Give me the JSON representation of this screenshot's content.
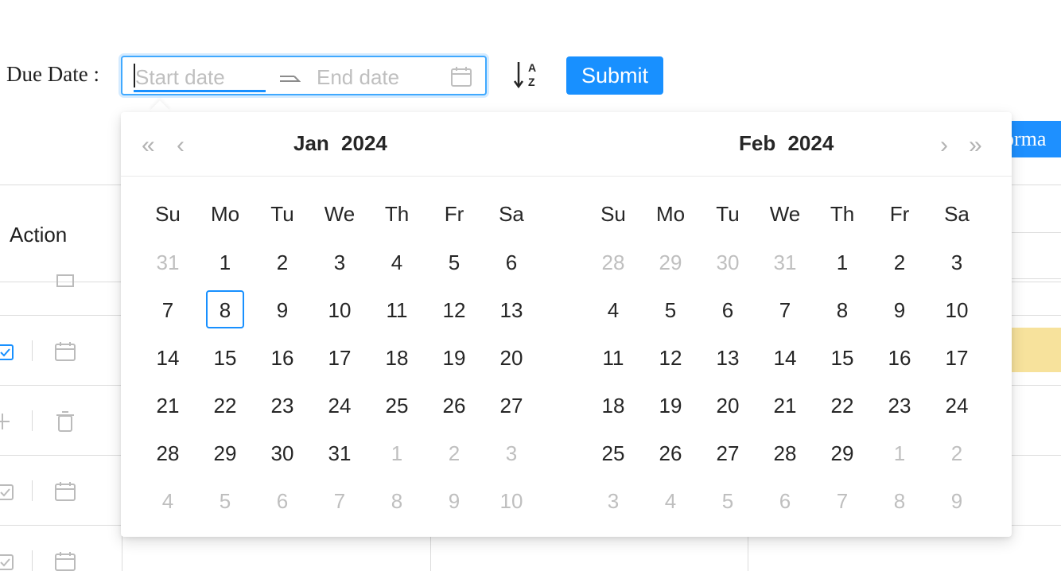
{
  "form": {
    "label": "Due Date :",
    "start_placeholder": "Start date",
    "end_placeholder": "End date",
    "submit_label": "Submit",
    "sort_icon": "sort-alpha-icon",
    "calendar_icon": "calendar-icon"
  },
  "background": {
    "column_header": "Action",
    "partial_button_label": "orma",
    "accent_color": "#1890ff",
    "highlight_color": "#f7e29c"
  },
  "picker": {
    "weekdays": [
      "Su",
      "Mo",
      "Tu",
      "We",
      "Th",
      "Fr",
      "Sa"
    ],
    "left": {
      "month": "Jan",
      "year": "2024",
      "weeks": [
        [
          {
            "d": "31",
            "out": true
          },
          {
            "d": "1"
          },
          {
            "d": "2"
          },
          {
            "d": "3"
          },
          {
            "d": "4"
          },
          {
            "d": "5"
          },
          {
            "d": "6"
          }
        ],
        [
          {
            "d": "7"
          },
          {
            "d": "8",
            "today": true
          },
          {
            "d": "9"
          },
          {
            "d": "10"
          },
          {
            "d": "11"
          },
          {
            "d": "12"
          },
          {
            "d": "13"
          }
        ],
        [
          {
            "d": "14"
          },
          {
            "d": "15"
          },
          {
            "d": "16"
          },
          {
            "d": "17"
          },
          {
            "d": "18"
          },
          {
            "d": "19"
          },
          {
            "d": "20"
          }
        ],
        [
          {
            "d": "21"
          },
          {
            "d": "22"
          },
          {
            "d": "23"
          },
          {
            "d": "24"
          },
          {
            "d": "25"
          },
          {
            "d": "26"
          },
          {
            "d": "27"
          }
        ],
        [
          {
            "d": "28"
          },
          {
            "d": "29"
          },
          {
            "d": "30"
          },
          {
            "d": "31"
          },
          {
            "d": "1",
            "out": true
          },
          {
            "d": "2",
            "out": true
          },
          {
            "d": "3",
            "out": true
          }
        ],
        [
          {
            "d": "4",
            "out": true
          },
          {
            "d": "5",
            "out": true
          },
          {
            "d": "6",
            "out": true
          },
          {
            "d": "7",
            "out": true
          },
          {
            "d": "8",
            "out": true
          },
          {
            "d": "9",
            "out": true
          },
          {
            "d": "10",
            "out": true
          }
        ]
      ]
    },
    "right": {
      "month": "Feb",
      "year": "2024",
      "weeks": [
        [
          {
            "d": "28",
            "out": true
          },
          {
            "d": "29",
            "out": true
          },
          {
            "d": "30",
            "out": true
          },
          {
            "d": "31",
            "out": true
          },
          {
            "d": "1"
          },
          {
            "d": "2"
          },
          {
            "d": "3"
          }
        ],
        [
          {
            "d": "4"
          },
          {
            "d": "5"
          },
          {
            "d": "6"
          },
          {
            "d": "7"
          },
          {
            "d": "8"
          },
          {
            "d": "9"
          },
          {
            "d": "10"
          }
        ],
        [
          {
            "d": "11"
          },
          {
            "d": "12"
          },
          {
            "d": "13"
          },
          {
            "d": "14"
          },
          {
            "d": "15"
          },
          {
            "d": "16"
          },
          {
            "d": "17"
          }
        ],
        [
          {
            "d": "18"
          },
          {
            "d": "19"
          },
          {
            "d": "20"
          },
          {
            "d": "21"
          },
          {
            "d": "22"
          },
          {
            "d": "23"
          },
          {
            "d": "24"
          }
        ],
        [
          {
            "d": "25"
          },
          {
            "d": "26"
          },
          {
            "d": "27"
          },
          {
            "d": "28"
          },
          {
            "d": "29"
          },
          {
            "d": "1",
            "out": true
          },
          {
            "d": "2",
            "out": true
          }
        ],
        [
          {
            "d": "3",
            "out": true
          },
          {
            "d": "4",
            "out": true
          },
          {
            "d": "5",
            "out": true
          },
          {
            "d": "6",
            "out": true
          },
          {
            "d": "7",
            "out": true
          },
          {
            "d": "8",
            "out": true
          },
          {
            "d": "9",
            "out": true
          }
        ]
      ]
    },
    "nav": {
      "super_prev": "«",
      "prev": "‹",
      "next": "›",
      "super_next": "»"
    }
  }
}
